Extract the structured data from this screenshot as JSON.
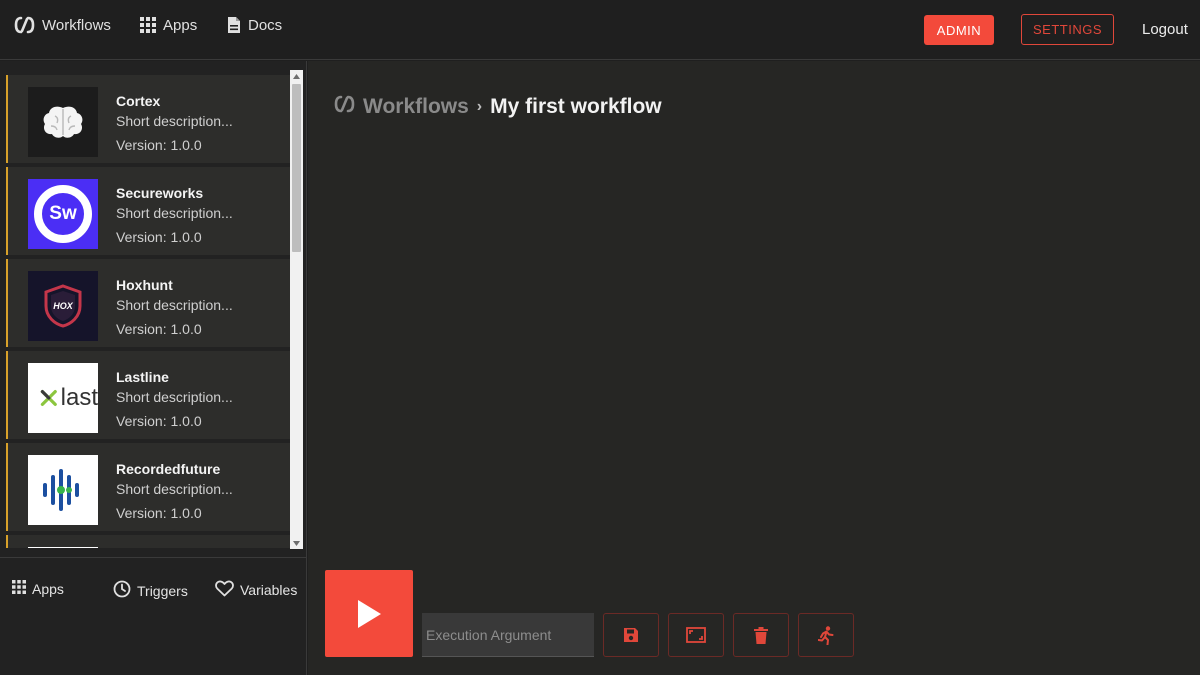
{
  "nav": {
    "workflows": "Workflows",
    "apps": "Apps",
    "docs": "Docs",
    "admin": "ADMIN",
    "settings": "SETTINGS",
    "logout": "Logout"
  },
  "apps": [
    {
      "name": "Cortex",
      "description": "Short description...",
      "version": "Version: 1.0.0",
      "icon": "brain-icon"
    },
    {
      "name": "Secureworks",
      "description": "Short description...",
      "version": "Version: 1.0.0",
      "icon": "secureworks-logo",
      "logo_text": "Sw"
    },
    {
      "name": "Hoxhunt",
      "description": "Short description...",
      "version": "Version: 1.0.0",
      "icon": "hoxhunt-logo",
      "logo_text": "HOX"
    },
    {
      "name": "Lastline",
      "description": "Short description...",
      "version": "Version: 1.0.0",
      "icon": "lastline-logo",
      "logo_text": "last"
    },
    {
      "name": "Recordedfuture",
      "description": "Short description...",
      "version": "Version: 1.0.0",
      "icon": "recordedfuture-logo"
    }
  ],
  "sidebar_tabs": {
    "apps": "Apps",
    "triggers": "Triggers",
    "variables": "Variables"
  },
  "breadcrumb": {
    "root": "Workflows",
    "separator": "›",
    "current": "My first workflow"
  },
  "execution": {
    "placeholder": "Execution Argument"
  },
  "colors": {
    "accent": "#f34a3b",
    "card_border": "#d8a12a",
    "background": "#1f1f1f",
    "canvas": "#262624"
  }
}
